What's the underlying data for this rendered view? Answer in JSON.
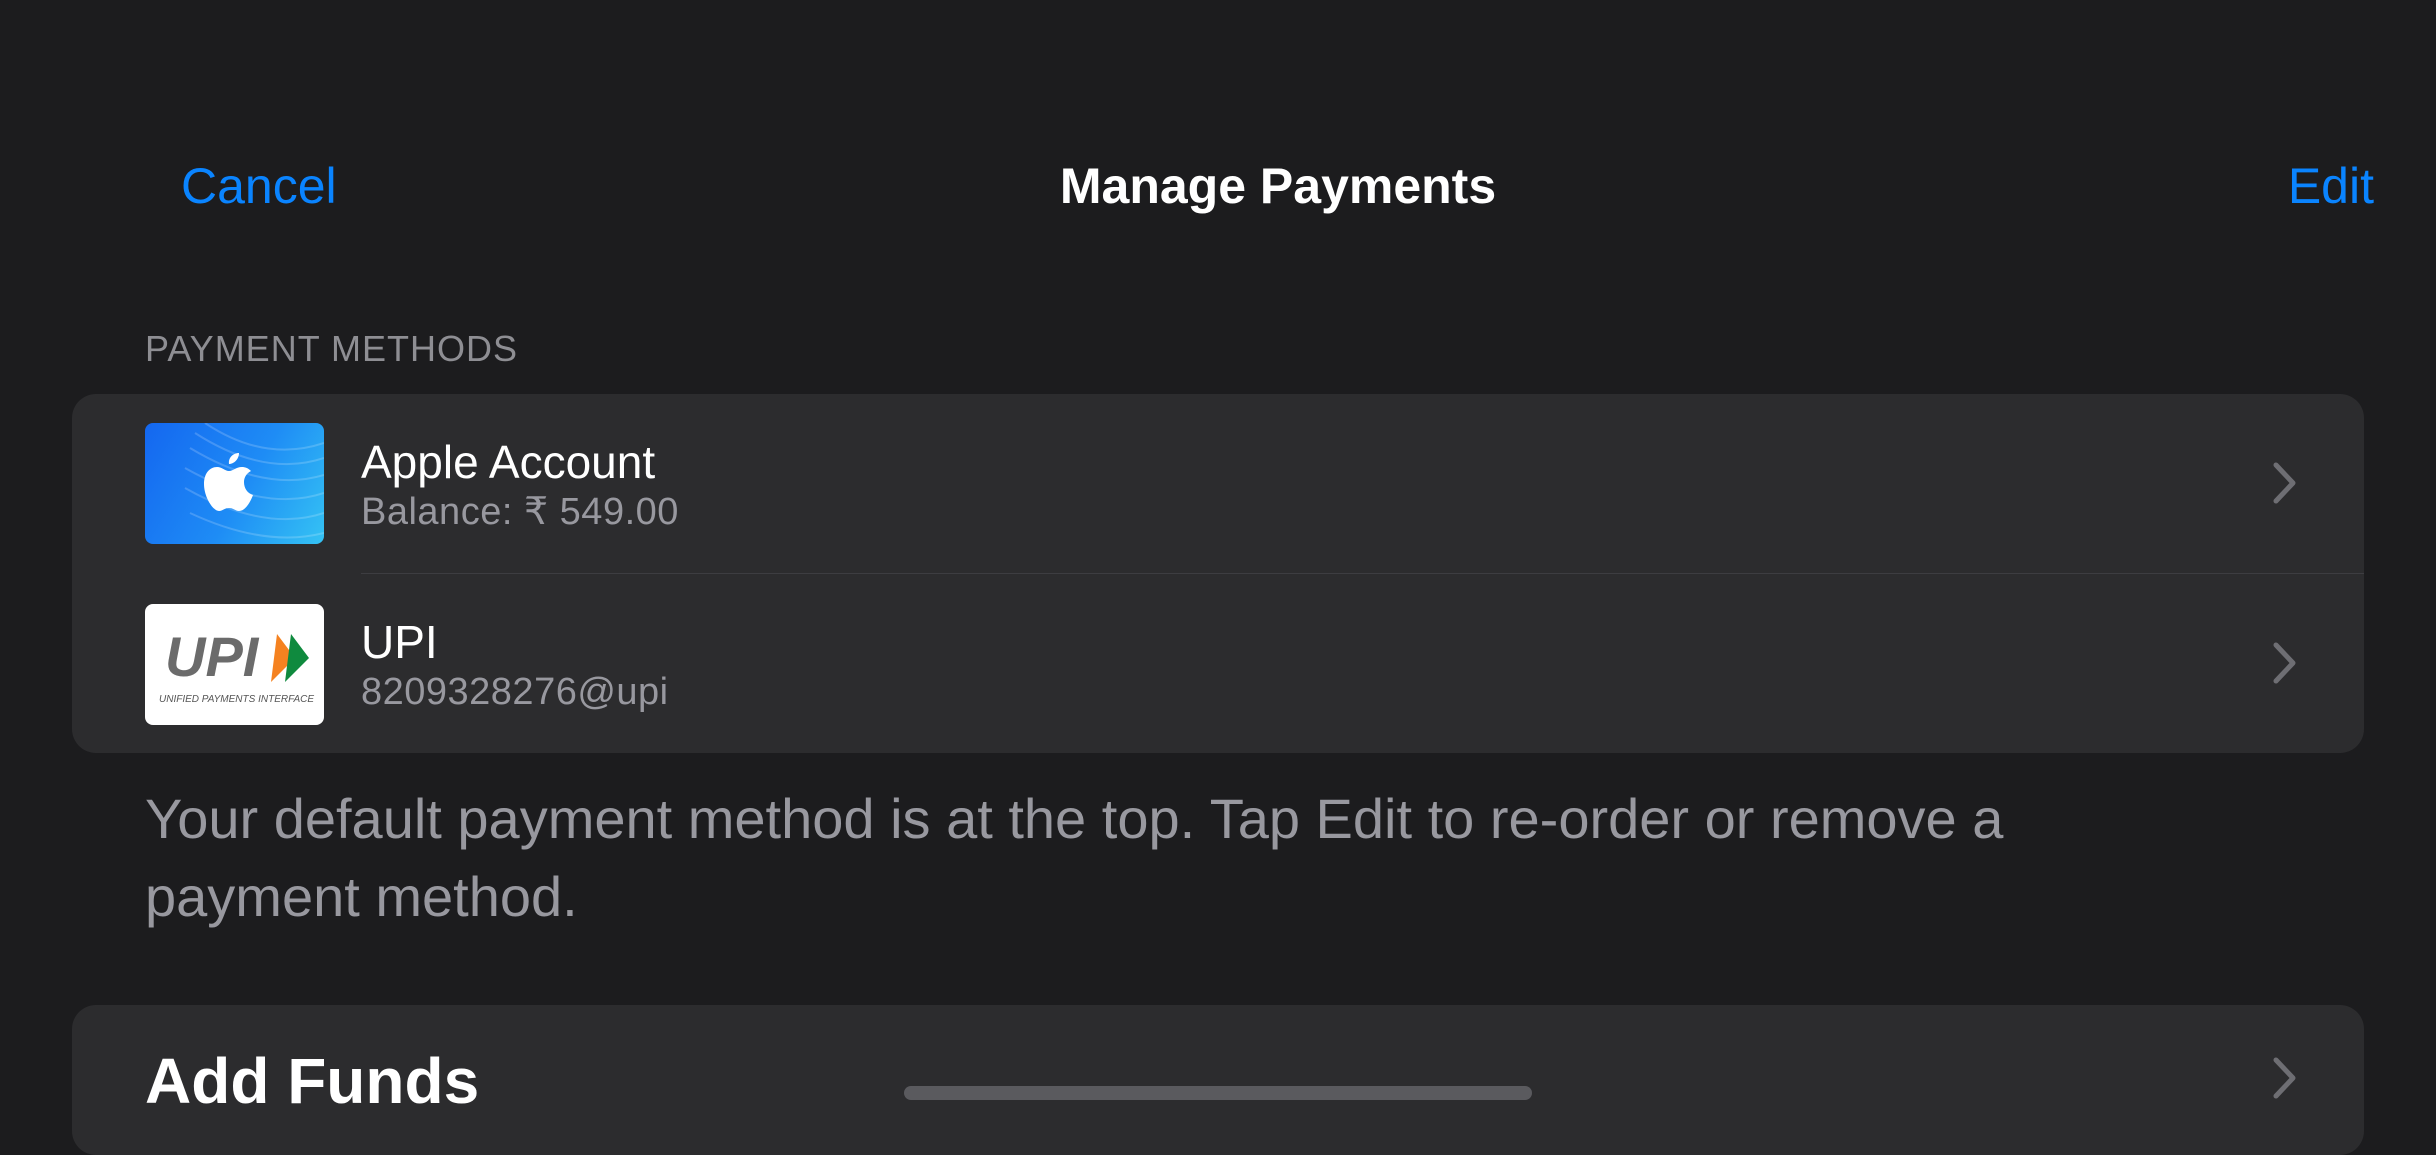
{
  "nav": {
    "cancel_label": "Cancel",
    "title": "Manage Payments",
    "edit_label": "Edit"
  },
  "payment_methods": {
    "header": "PAYMENT METHODS",
    "items": [
      {
        "title": "Apple Account",
        "subtitle": "Balance: ₹ 549.00",
        "icon": "apple-logo-icon"
      },
      {
        "title": "UPI",
        "subtitle": "8209328276@upi",
        "icon": "upi-logo-icon",
        "logo_text": "UPI",
        "logo_tagline": "UNIFIED PAYMENTS INTERFACE"
      }
    ],
    "footer": "Your default payment method is at the top. Tap Edit to re-order or remove a payment method."
  },
  "add_funds": {
    "label": "Add Funds"
  },
  "colors": {
    "background": "#1c1c1e",
    "group_background": "#2c2c2e",
    "accent": "#0a84ff",
    "secondary_text": "#98989f"
  }
}
